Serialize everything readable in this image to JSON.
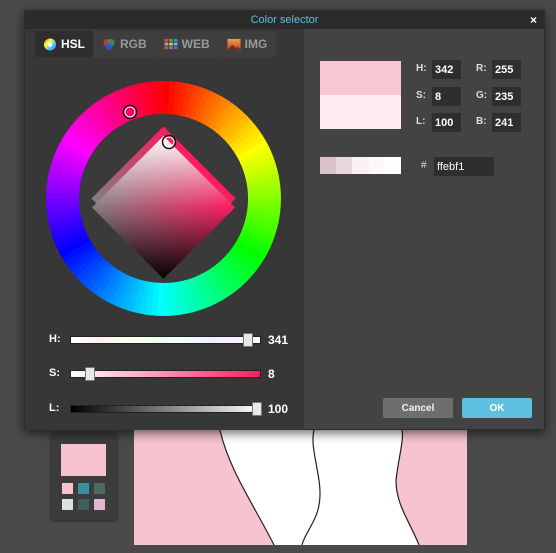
{
  "dialog": {
    "title": "Color selector",
    "close_glyph": "×"
  },
  "tabs": [
    {
      "label": "HSL",
      "icon": "hsl-wheel-icon",
      "active": true
    },
    {
      "label": "RGB",
      "icon": "rgb-circles-icon",
      "active": false
    },
    {
      "label": "WEB",
      "icon": "web-grid-icon",
      "active": false
    },
    {
      "label": "IMG",
      "icon": "image-icon",
      "active": false
    }
  ],
  "sliders": {
    "h": {
      "label": "H:",
      "value": "341",
      "fraction": 0.948
    },
    "s": {
      "label": "S:",
      "value": "8",
      "fraction": 0.08
    },
    "l": {
      "label": "L:",
      "value": "100",
      "fraction": 1.0
    }
  },
  "fields": {
    "h": {
      "label": "H:",
      "value": "342"
    },
    "s": {
      "label": "S:",
      "value": "8"
    },
    "l": {
      "label": "L:",
      "value": "100"
    },
    "r": {
      "label": "R:",
      "value": "255"
    },
    "g": {
      "label": "G:",
      "value": "235"
    },
    "b": {
      "label": "B:",
      "value": "241"
    }
  },
  "hex": {
    "label": "#",
    "value": "ffebf1"
  },
  "buttons": {
    "cancel": "Cancel",
    "ok": "OK"
  },
  "colors": {
    "preview_new": "#f7c7d3",
    "preview_old": "#ffebf1",
    "accent": "#5ec0e0",
    "history": [
      "#d9c1c8",
      "#e8d8dd",
      "#fbf1f4",
      "#fff8fa",
      "#fffdfe"
    ],
    "side_swatch": "#f6c3cf",
    "mini_swatches": [
      "#f6c3cf",
      "#3a8fa5",
      "#4c6966",
      "#d8e3e0",
      "#3f5f5c",
      "#e0b5d1"
    ],
    "canvas_fill": "#f6c3cf"
  }
}
